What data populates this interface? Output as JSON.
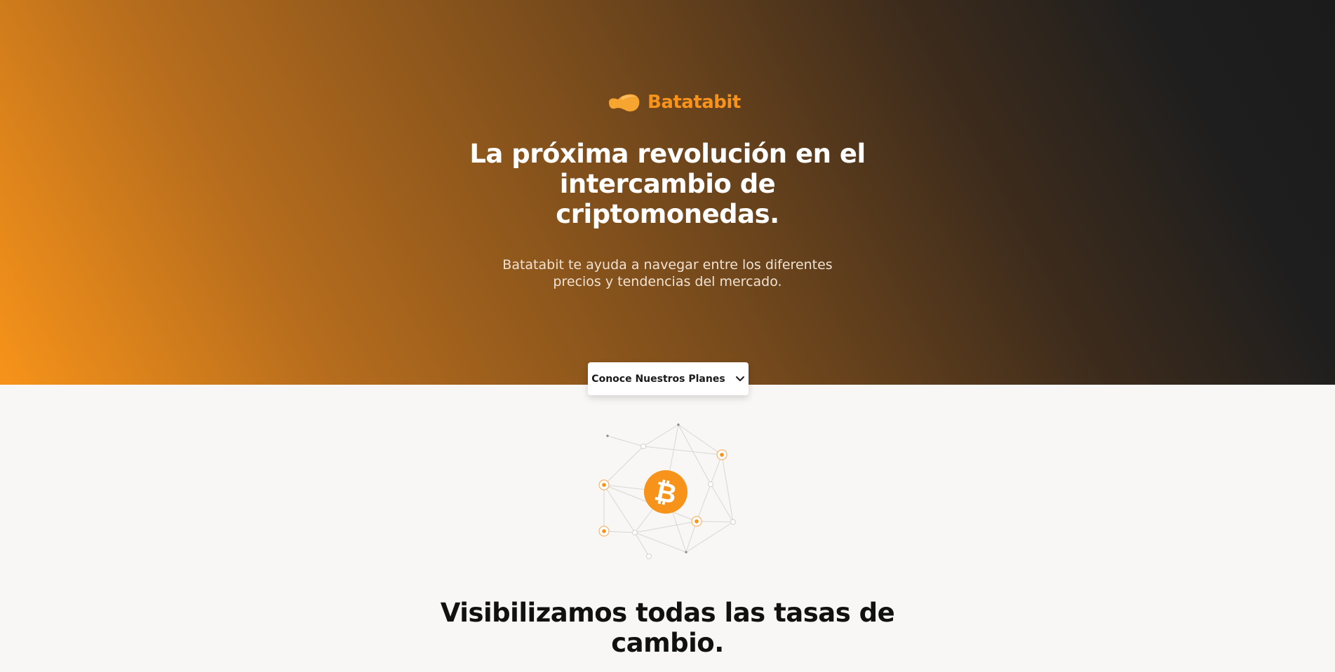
{
  "brand": {
    "name": "Batatabit",
    "color": "#f7931a"
  },
  "hero": {
    "title": "La próxima revolución en el intercambio de criptomonedas.",
    "subtitle": "Batatabit te ayuda a navegar entre los diferentes precios y tendencias del mercado.",
    "plans_button_label": "Conoce Nuestros Planes",
    "plans_button_icon": "chevron-down-icon"
  },
  "illustration": {
    "icon": "bitcoin-icon",
    "symbol": "₿",
    "accent": "#f7931a"
  },
  "rates_section": {
    "title": "Visibilizamos todas las tasas de cambio."
  }
}
